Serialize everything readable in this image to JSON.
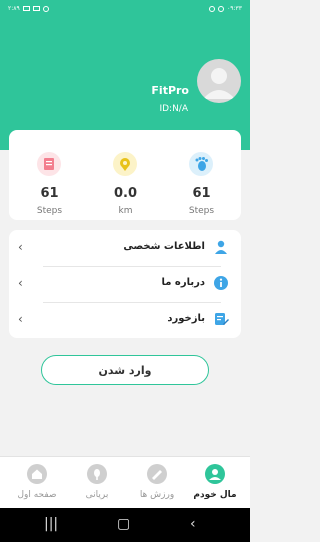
{
  "status_bar": {
    "left_text": "۲:۸۹",
    "right_text": "۰۹:۳۳"
  },
  "profile": {
    "app_name": "FitPro",
    "user_id": "ID:N/A"
  },
  "stats": [
    {
      "value": "61",
      "unit": "Steps",
      "icon": "steps-book-icon",
      "icon_color": "#f37e8e",
      "icon_bg": "#fde4e7"
    },
    {
      "value": "0.0",
      "unit": "km",
      "icon": "distance-pin-icon",
      "icon_color": "#e8c21a",
      "icon_bg": "#fcf3c8"
    },
    {
      "value": "61",
      "unit": "Steps",
      "icon": "footprint-icon",
      "icon_color": "#3ea5e6",
      "icon_bg": "#dcf0fb"
    }
  ],
  "menu": [
    {
      "label": "اطلاعات شخصی",
      "icon": "person-icon"
    },
    {
      "label": "درباره ما",
      "icon": "info-icon"
    },
    {
      "label": "بازخورد",
      "icon": "feedback-icon"
    }
  ],
  "login_button": "وارد شدن",
  "bottom_nav": [
    {
      "label": "صفحه اول",
      "icon": "home-icon",
      "active": false
    },
    {
      "label": "بریانی",
      "icon": "food-icon",
      "active": false
    },
    {
      "label": "ورزش ها",
      "icon": "sports-icon",
      "active": false
    },
    {
      "label": "مال خودم",
      "icon": "profile-icon",
      "active": true
    }
  ],
  "colors": {
    "accent": "#2fc59a"
  }
}
